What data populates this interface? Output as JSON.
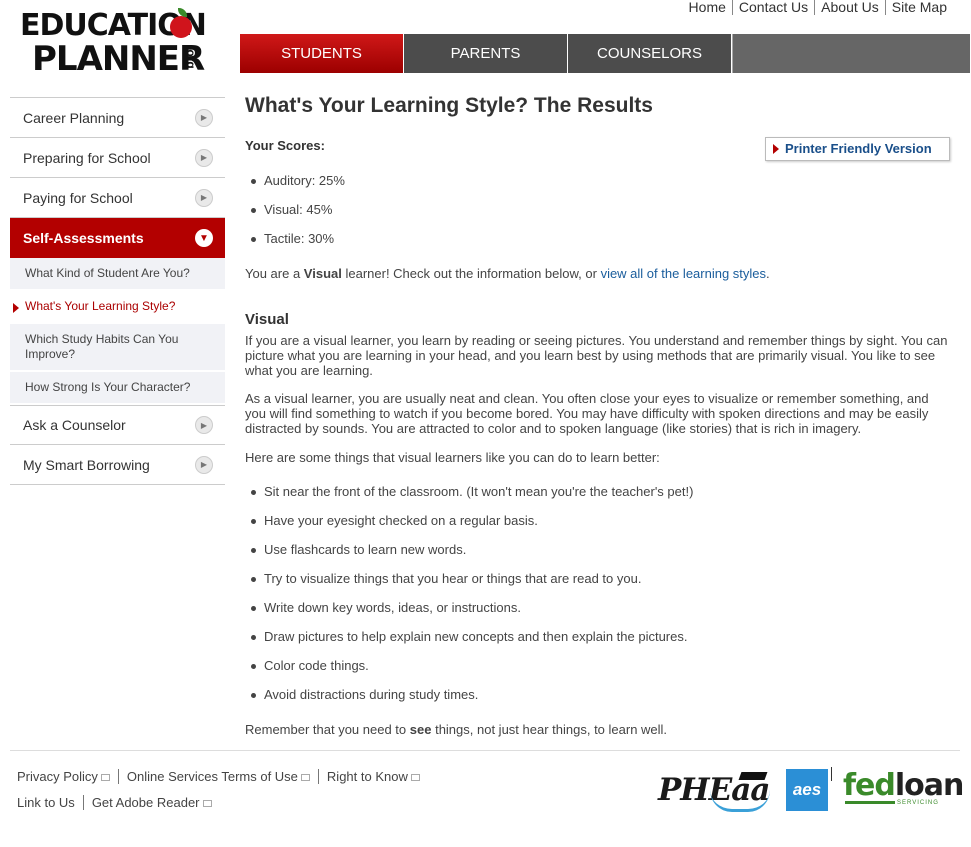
{
  "logo": {
    "line1": "EDUCATION",
    "line2": "PLANNER",
    "suffix": ".org"
  },
  "topnav": [
    "Home",
    "Contact Us",
    "About Us",
    "Site Map"
  ],
  "tabs": [
    "STUDENTS",
    "PARENTS",
    "COUNSELORS"
  ],
  "sidebar": {
    "items": [
      {
        "label": "Career Planning"
      },
      {
        "label": "Preparing for School"
      },
      {
        "label": "Paying for School"
      },
      {
        "label": "Self-Assessments"
      },
      {
        "label": "Ask a Counselor"
      },
      {
        "label": "My Smart Borrowing"
      }
    ],
    "subitems": [
      {
        "label": "What Kind of Student Are You?"
      },
      {
        "label": "What's Your Learning Style?"
      },
      {
        "label": "Which Study Habits Can You Improve?"
      },
      {
        "label": "How Strong Is Your Character?"
      }
    ]
  },
  "main": {
    "title": "What's Your Learning Style? The Results",
    "scores_label": "Your Scores:",
    "printer_label": "Printer Friendly Version",
    "scores": [
      "Auditory: 25%",
      "Visual: 45%",
      "Tactile: 30%"
    ],
    "learner_pre": "You are a ",
    "learner_bold": "Visual",
    "learner_mid": " learner! Check out the information below, or ",
    "learner_link": "view all of the learning styles",
    "learner_end": ".",
    "visual_heading": "Visual",
    "para1": "If you are a visual learner, you learn by reading or seeing pictures. You understand and remember things by sight. You can picture what you are learning in your head, and you learn best by using methods that are primarily visual. You like to see what you are learning.",
    "para2": "As a visual learner, you are usually neat and clean. You often close your eyes to visualize or remember something, and you will find something to watch if you become bored. You may have difficulty with spoken directions and may be easily distracted by sounds. You are attracted to color and to spoken language (like stories) that is rich in imagery.",
    "para3": "Here are some things that visual learners like you can do to learn better:",
    "tips": [
      "Sit near the front of the classroom. (It won't mean you're the teacher's pet!)",
      "Have your eyesight checked on a regular basis.",
      "Use flashcards to learn new words.",
      "Try to visualize things that you hear or things that are read to you.",
      "Write down key words, ideas, or instructions.",
      "Draw pictures to help explain new concepts and then explain the pictures.",
      "Color code things.",
      "Avoid distractions during study times."
    ],
    "remember_pre": "Remember that you need to ",
    "remember_bold": "see",
    "remember_end": " things, not just hear things, to learn well."
  },
  "footer": {
    "row1": [
      "Privacy Policy",
      "Online Services Terms of Use",
      "Right to Know"
    ],
    "row2": [
      "Link to Us",
      "Get Adobe Reader"
    ],
    "logos": {
      "pheaa": "PHEaa",
      "aes": "aes",
      "fed": "fed",
      "loan": "loan",
      "servicing": "SERVICING"
    }
  }
}
